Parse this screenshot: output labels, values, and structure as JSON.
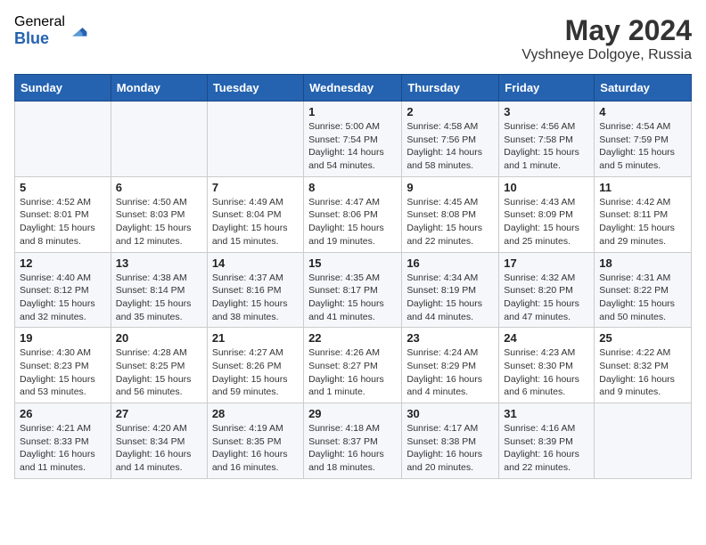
{
  "logo": {
    "general": "General",
    "blue": "Blue"
  },
  "title": {
    "month_year": "May 2024",
    "location": "Vyshneye Dolgoye, Russia"
  },
  "weekdays": [
    "Sunday",
    "Monday",
    "Tuesday",
    "Wednesday",
    "Thursday",
    "Friday",
    "Saturday"
  ],
  "weeks": [
    [
      {
        "day": "",
        "info": ""
      },
      {
        "day": "",
        "info": ""
      },
      {
        "day": "",
        "info": ""
      },
      {
        "day": "1",
        "info": "Sunrise: 5:00 AM\nSunset: 7:54 PM\nDaylight: 14 hours\nand 54 minutes."
      },
      {
        "day": "2",
        "info": "Sunrise: 4:58 AM\nSunset: 7:56 PM\nDaylight: 14 hours\nand 58 minutes."
      },
      {
        "day": "3",
        "info": "Sunrise: 4:56 AM\nSunset: 7:58 PM\nDaylight: 15 hours\nand 1 minute."
      },
      {
        "day": "4",
        "info": "Sunrise: 4:54 AM\nSunset: 7:59 PM\nDaylight: 15 hours\nand 5 minutes."
      }
    ],
    [
      {
        "day": "5",
        "info": "Sunrise: 4:52 AM\nSunset: 8:01 PM\nDaylight: 15 hours\nand 8 minutes."
      },
      {
        "day": "6",
        "info": "Sunrise: 4:50 AM\nSunset: 8:03 PM\nDaylight: 15 hours\nand 12 minutes."
      },
      {
        "day": "7",
        "info": "Sunrise: 4:49 AM\nSunset: 8:04 PM\nDaylight: 15 hours\nand 15 minutes."
      },
      {
        "day": "8",
        "info": "Sunrise: 4:47 AM\nSunset: 8:06 PM\nDaylight: 15 hours\nand 19 minutes."
      },
      {
        "day": "9",
        "info": "Sunrise: 4:45 AM\nSunset: 8:08 PM\nDaylight: 15 hours\nand 22 minutes."
      },
      {
        "day": "10",
        "info": "Sunrise: 4:43 AM\nSunset: 8:09 PM\nDaylight: 15 hours\nand 25 minutes."
      },
      {
        "day": "11",
        "info": "Sunrise: 4:42 AM\nSunset: 8:11 PM\nDaylight: 15 hours\nand 29 minutes."
      }
    ],
    [
      {
        "day": "12",
        "info": "Sunrise: 4:40 AM\nSunset: 8:12 PM\nDaylight: 15 hours\nand 32 minutes."
      },
      {
        "day": "13",
        "info": "Sunrise: 4:38 AM\nSunset: 8:14 PM\nDaylight: 15 hours\nand 35 minutes."
      },
      {
        "day": "14",
        "info": "Sunrise: 4:37 AM\nSunset: 8:16 PM\nDaylight: 15 hours\nand 38 minutes."
      },
      {
        "day": "15",
        "info": "Sunrise: 4:35 AM\nSunset: 8:17 PM\nDaylight: 15 hours\nand 41 minutes."
      },
      {
        "day": "16",
        "info": "Sunrise: 4:34 AM\nSunset: 8:19 PM\nDaylight: 15 hours\nand 44 minutes."
      },
      {
        "day": "17",
        "info": "Sunrise: 4:32 AM\nSunset: 8:20 PM\nDaylight: 15 hours\nand 47 minutes."
      },
      {
        "day": "18",
        "info": "Sunrise: 4:31 AM\nSunset: 8:22 PM\nDaylight: 15 hours\nand 50 minutes."
      }
    ],
    [
      {
        "day": "19",
        "info": "Sunrise: 4:30 AM\nSunset: 8:23 PM\nDaylight: 15 hours\nand 53 minutes."
      },
      {
        "day": "20",
        "info": "Sunrise: 4:28 AM\nSunset: 8:25 PM\nDaylight: 15 hours\nand 56 minutes."
      },
      {
        "day": "21",
        "info": "Sunrise: 4:27 AM\nSunset: 8:26 PM\nDaylight: 15 hours\nand 59 minutes."
      },
      {
        "day": "22",
        "info": "Sunrise: 4:26 AM\nSunset: 8:27 PM\nDaylight: 16 hours\nand 1 minute."
      },
      {
        "day": "23",
        "info": "Sunrise: 4:24 AM\nSunset: 8:29 PM\nDaylight: 16 hours\nand 4 minutes."
      },
      {
        "day": "24",
        "info": "Sunrise: 4:23 AM\nSunset: 8:30 PM\nDaylight: 16 hours\nand 6 minutes."
      },
      {
        "day": "25",
        "info": "Sunrise: 4:22 AM\nSunset: 8:32 PM\nDaylight: 16 hours\nand 9 minutes."
      }
    ],
    [
      {
        "day": "26",
        "info": "Sunrise: 4:21 AM\nSunset: 8:33 PM\nDaylight: 16 hours\nand 11 minutes."
      },
      {
        "day": "27",
        "info": "Sunrise: 4:20 AM\nSunset: 8:34 PM\nDaylight: 16 hours\nand 14 minutes."
      },
      {
        "day": "28",
        "info": "Sunrise: 4:19 AM\nSunset: 8:35 PM\nDaylight: 16 hours\nand 16 minutes."
      },
      {
        "day": "29",
        "info": "Sunrise: 4:18 AM\nSunset: 8:37 PM\nDaylight: 16 hours\nand 18 minutes."
      },
      {
        "day": "30",
        "info": "Sunrise: 4:17 AM\nSunset: 8:38 PM\nDaylight: 16 hours\nand 20 minutes."
      },
      {
        "day": "31",
        "info": "Sunrise: 4:16 AM\nSunset: 8:39 PM\nDaylight: 16 hours\nand 22 minutes."
      },
      {
        "day": "",
        "info": ""
      }
    ]
  ]
}
